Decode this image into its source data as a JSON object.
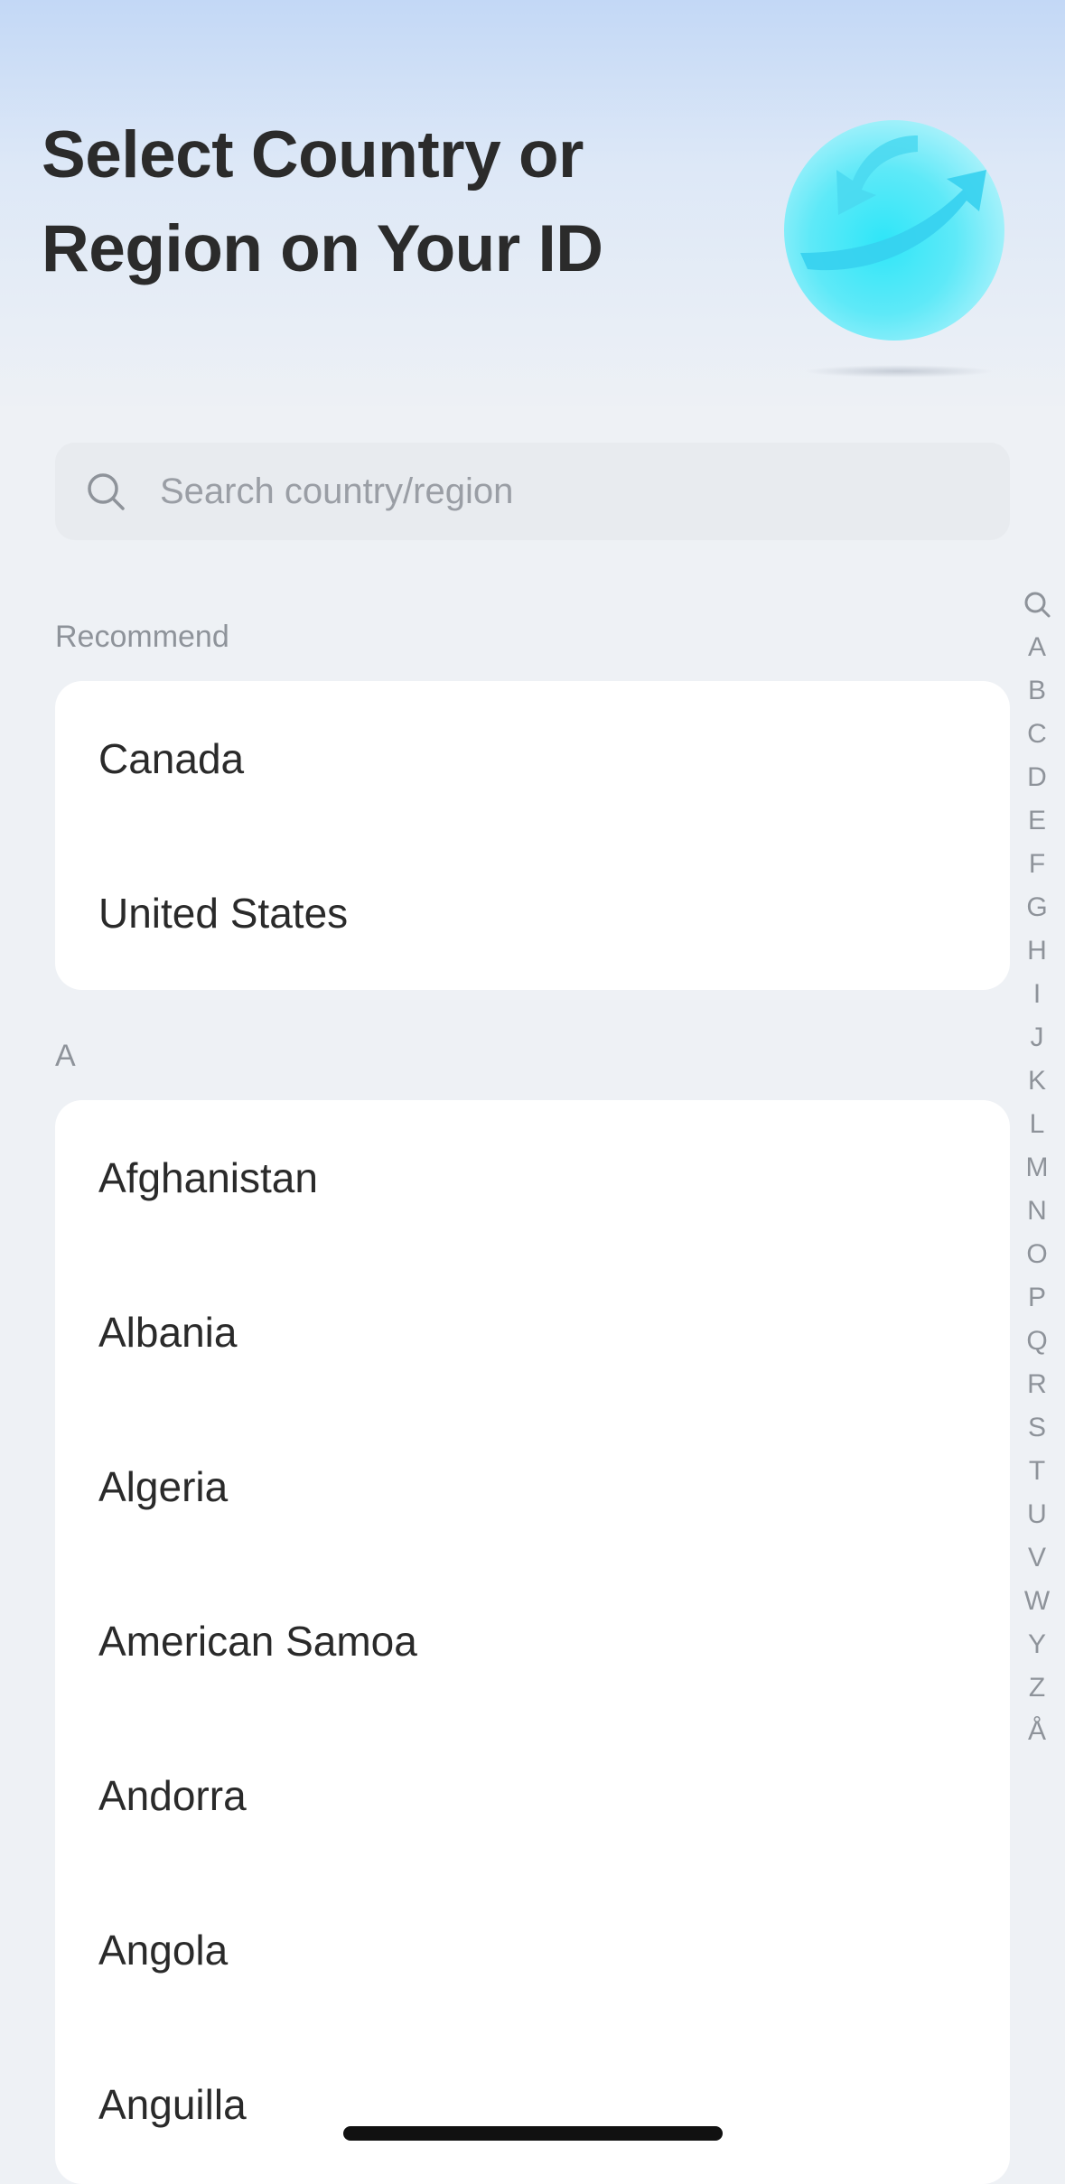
{
  "header": {
    "title_line1": "Select Country or",
    "title_line2": "Region on Your ID",
    "illustration_icon": "globe-sync-icon"
  },
  "search": {
    "placeholder": "Search country/region",
    "icon": "search-icon"
  },
  "sections": [
    {
      "label": "Recommend",
      "items": [
        "Canada",
        "United States"
      ]
    },
    {
      "label": "A",
      "items": [
        "Afghanistan",
        "Albania",
        "Algeria",
        "American Samoa",
        "Andorra",
        "Angola",
        "Anguilla"
      ]
    }
  ],
  "index_bar": {
    "search_icon": "search-icon",
    "letters": [
      "A",
      "B",
      "C",
      "D",
      "E",
      "F",
      "G",
      "H",
      "I",
      "J",
      "K",
      "L",
      "M",
      "N",
      "O",
      "P",
      "Q",
      "R",
      "S",
      "T",
      "U",
      "V",
      "W",
      "Y",
      "Z",
      "Å"
    ]
  },
  "colors": {
    "accent_cyan": "#3fe3f7",
    "header_gradient_top": "#c3d8f6",
    "background": "#eef1f5"
  }
}
